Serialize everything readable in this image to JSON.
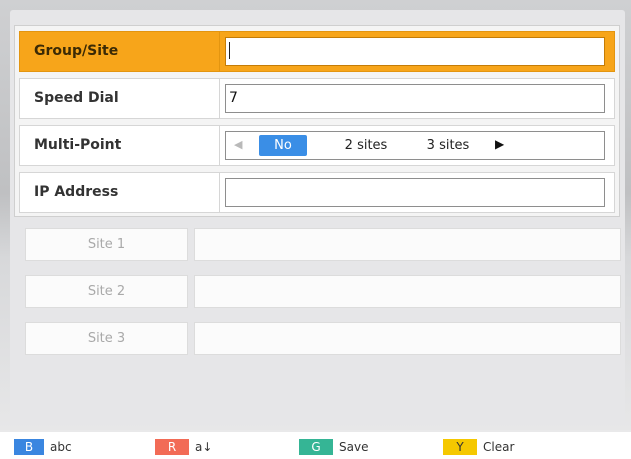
{
  "form": {
    "rows": [
      {
        "label": "Group/Site",
        "value": ""
      },
      {
        "label": "Speed Dial",
        "value": "7"
      },
      {
        "label": "Multi-Point",
        "options": [
          "No",
          "2 sites",
          "3 sites"
        ],
        "selected": "No"
      },
      {
        "label": "IP Address",
        "value": ""
      }
    ],
    "sites": [
      {
        "label": "Site 1"
      },
      {
        "label": "Site 2"
      },
      {
        "label": "Site 3"
      }
    ]
  },
  "hints": [
    {
      "key": "B",
      "label": "abc",
      "color": "#3a86e0"
    },
    {
      "key": "R",
      "label": "a↓",
      "color": "#f26b56"
    },
    {
      "key": "G",
      "label": "Save",
      "color": "#35b595"
    },
    {
      "key": "Y",
      "label": "Clear",
      "color": "#f5c800"
    }
  ],
  "colors": {
    "selected_row": "#f7a51a",
    "active_option": "#3a8ee6"
  },
  "icons": {
    "left_arrow": "triangle-left-icon",
    "right_arrow": "triangle-right-icon"
  }
}
